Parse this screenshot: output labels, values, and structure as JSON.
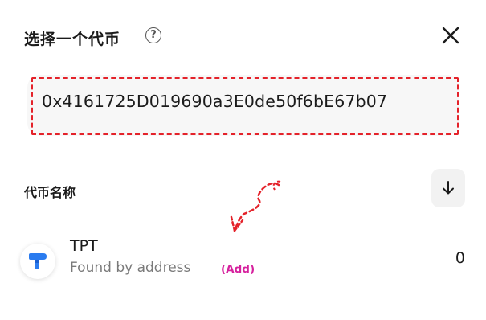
{
  "header": {
    "title": "选择一个代币",
    "help_icon": "question-circle-icon",
    "help_glyph": "?",
    "close_icon": "close-icon"
  },
  "search": {
    "value": "0x4161725D019690a3E0de50f6bE67b07"
  },
  "list": {
    "section_label": "代币名称",
    "sort_icon": "arrow-down-icon",
    "tokens": [
      {
        "symbol": "TPT",
        "subtitle": "Found by address",
        "add_label": "(Add)",
        "balance": "0",
        "logo_icon": "tpt-logo-icon"
      }
    ]
  },
  "colors": {
    "annotation_red": "#e4222a",
    "add_link": "#d6219e",
    "tpt_blue": "#2a7bef"
  }
}
